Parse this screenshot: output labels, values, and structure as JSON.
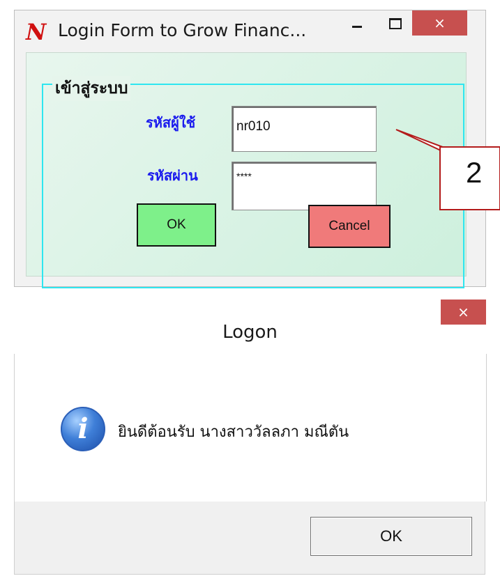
{
  "login_window": {
    "title": "Login Form to Grow Financ...",
    "icon": "N-logo",
    "close_symbol": "×",
    "group_label": "เข้าสู่ระบบ",
    "username_label": "รหัสผู้ใช้",
    "username_value": "nr010",
    "password_label": "รหัสผ่าน",
    "password_value": "****",
    "ok_label": "OK",
    "cancel_label": "Cancel",
    "colors": {
      "ok": "#7ef08a",
      "cancel": "#f07a7a",
      "group_border": "#2ee6f0",
      "label": "#1a1aee"
    }
  },
  "callout": {
    "number": "2",
    "border_color": "#b31b1b"
  },
  "logon_dialog": {
    "title": "Logon",
    "close_symbol": "×",
    "icon": "info-icon",
    "message": "ยินดีต้อนรับ นางสาววัลลภา  มณีตัน",
    "ok_label": "OK"
  }
}
